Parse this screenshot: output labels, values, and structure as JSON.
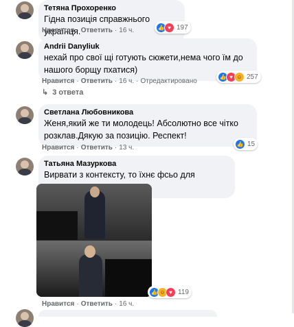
{
  "comments": [
    {
      "author": "Тетяна Прохоренко",
      "text": "Гідна позиція справжнього українця.",
      "like_label": "Нравится",
      "reply_label": "Ответить",
      "time": "16 ч.",
      "reaction_count": "197"
    },
    {
      "author": "Andrii Danyliuk",
      "text": "нехай про свої щі готують сюжети,нема чого їм до нашого борщу пхатися)",
      "like_label": "Нравится",
      "reply_label": "Ответить",
      "time": "16 ч.",
      "edited": "Отредактировано",
      "reaction_count": "257",
      "replies": "3 ответа"
    },
    {
      "author": "Светлана Любовникова",
      "text": "Женя,який же ти молодець! Абсолютно все чітко розклав.Дякую за позицію. Респект!",
      "like_label": "Нравится",
      "reply_label": "Ответить",
      "time": "13 ч.",
      "reaction_count": "15"
    },
    {
      "author": "Татьяна Мазуркова",
      "text": "Вирвати з контексту, то їхнє фсьо для пропаганди",
      "like_label": "Нравится",
      "reply_label": "Ответить",
      "time": "16 ч.",
      "reaction_count": "119"
    }
  ],
  "separator": "·",
  "colors": {
    "like": "#1877f2",
    "love": "#f33e58",
    "haha": "#f7b125",
    "meta": "#65676b",
    "bubble": "#f0f2f5"
  }
}
